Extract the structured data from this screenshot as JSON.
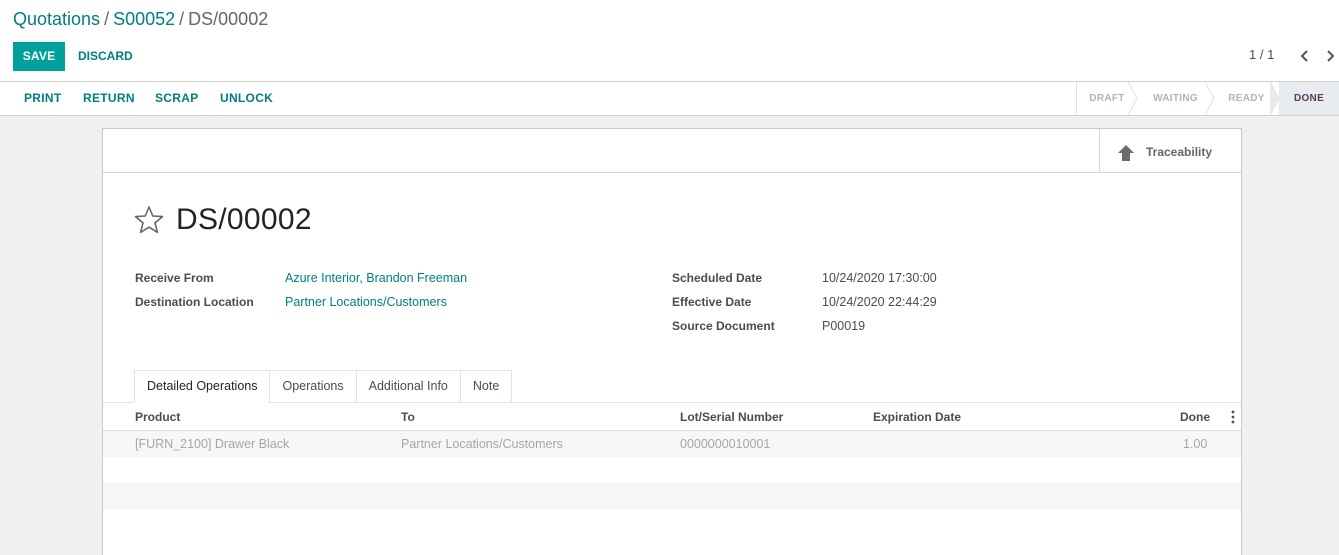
{
  "breadcrumb": {
    "items": [
      "Quotations",
      "S00052"
    ],
    "separator": "/",
    "current": "DS/00002"
  },
  "actions": {
    "save": "SAVE",
    "discard": "DISCARD"
  },
  "pager": {
    "value": "1 / 1",
    "prev_icon": "chevron-left-icon",
    "next_icon": "chevron-right-icon"
  },
  "statusbar": {
    "buttons": [
      "PRINT",
      "RETURN",
      "SCRAP",
      "UNLOCK"
    ],
    "steps": [
      "DRAFT",
      "WAITING",
      "READY",
      "DONE"
    ],
    "active_step": "DONE"
  },
  "smart_button": {
    "label": "Traceability",
    "icon": "arrow-up-icon"
  },
  "record": {
    "title": "DS/00002",
    "favorite_icon": "star-outline-icon",
    "left_fields": [
      {
        "label": "Receive From",
        "value": "Azure Interior, Brandon Freeman"
      },
      {
        "label": "Destination Location",
        "value": "Partner Locations/Customers"
      }
    ],
    "right_fields": [
      {
        "label": "Scheduled Date",
        "value": "10/24/2020 17:30:00"
      },
      {
        "label": "Effective Date",
        "value": "10/24/2020 22:44:29"
      },
      {
        "label": "Source Document",
        "value": "P00019"
      }
    ]
  },
  "tabs": [
    "Detailed Operations",
    "Operations",
    "Additional Info",
    "Note"
  ],
  "active_tab": "Detailed Operations",
  "table": {
    "columns": [
      "Product",
      "To",
      "Lot/Serial Number",
      "Expiration Date",
      "Done"
    ],
    "rows": [
      {
        "product": "[FURN_2100] Drawer Black",
        "to": "Partner Locations/Customers",
        "lot": "0000000010001",
        "expiration": "",
        "done": "1.00"
      }
    ],
    "options_icon": "kebab-menu-icon"
  },
  "colors": {
    "primary": "#00a09d",
    "link": "#017e84",
    "active_status": "#5a3c58"
  }
}
